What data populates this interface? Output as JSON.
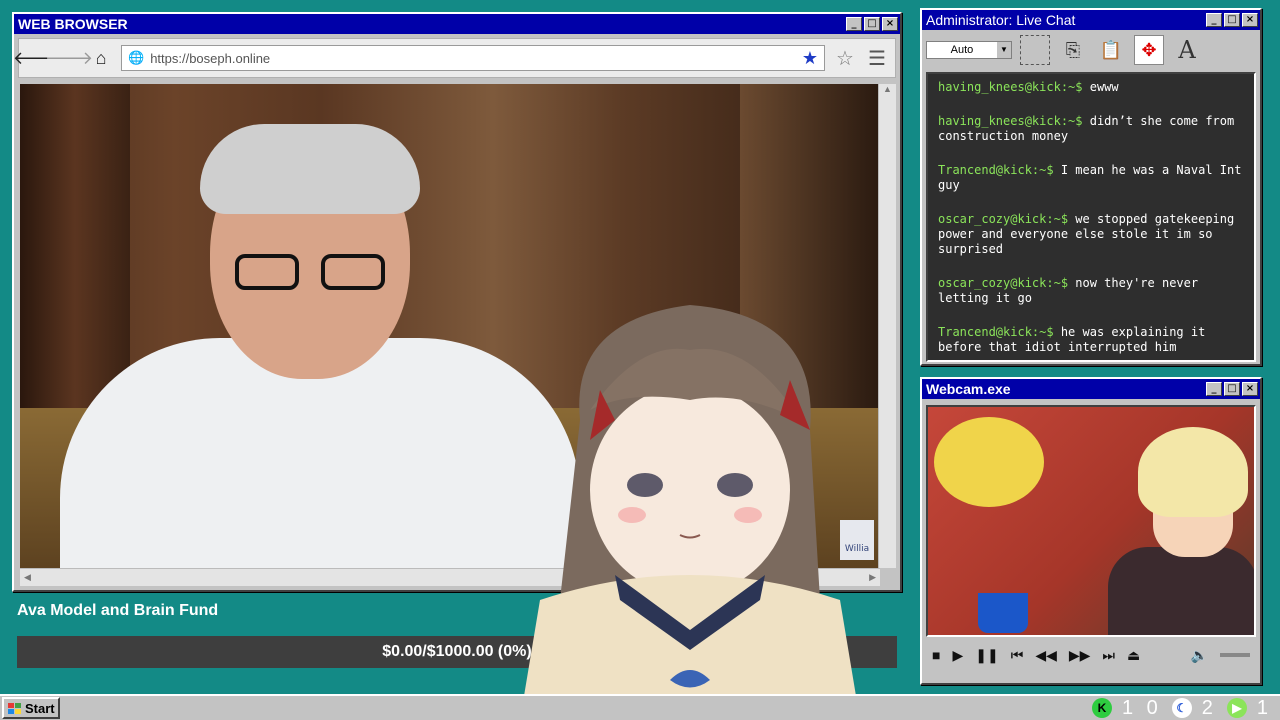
{
  "browser": {
    "title": "WEB BROWSER",
    "url": "https://boseph.online",
    "watermark": "Willia"
  },
  "chat": {
    "title": "Administrator: Live Chat",
    "font_size_select": "Auto",
    "messages": [
      {
        "user": "having_knees@kick:~$",
        "text": "ewww"
      },
      {
        "user": "having_knees@kick:~$",
        "text": "didn’t she come from construction money"
      },
      {
        "user": "Trancend@kick:~$",
        "text": "I mean he was a Naval Int guy"
      },
      {
        "user": "oscar_cozy@kick:~$",
        "text": "we stopped gatekeeping power and everyone else stole it im so surprised"
      },
      {
        "user": "oscar_cozy@kick:~$",
        "text": "now they're never letting it go"
      },
      {
        "user": "Trancend@kick:~$",
        "text": "he was explaining it before that idiot interrupted him"
      }
    ]
  },
  "webcam": {
    "title": "Webcam.exe"
  },
  "fund": {
    "title": "Ava Model and Brain Fund",
    "progress_text": "$0.00/$1000.00 (0%)",
    "progress_fraction": 0,
    "fill_color": "#2ecc71"
  },
  "taskbar": {
    "start_label": "Start",
    "tray_counts": [
      "1 0",
      "2",
      "1"
    ]
  },
  "colors": {
    "desktop": "#138a86",
    "titlebar": "#0000a8",
    "chat_user": "#8be45a"
  }
}
